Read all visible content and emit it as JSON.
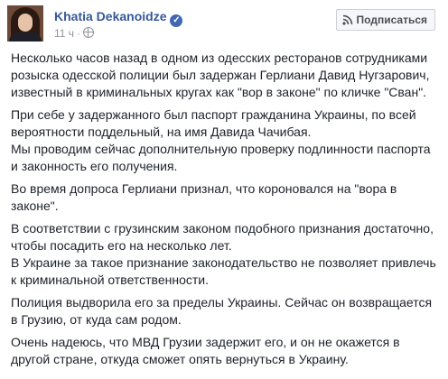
{
  "post": {
    "author": "Khatia Dekanoidze",
    "time": "11 ч",
    "subscribe_label": "Подписаться",
    "paragraphs": [
      "Несколько часов назад в одном из одесских ресторанов сотрудниками\nрозыска одесской полиции был задержан Герлиани Давид Нугзарович,\nизвестный в криминальных кругах как \"вор в законе\" по кличке \"Сван\".",
      "При себе у задержанного был паспорт гражданина Украины, по всей\nвероятности поддельный, на имя Давида Чачибая.\nМы проводим сейчас дополнительную проверку подлинности паспорта\nи законность его получения.",
      "Во время допроса Герлиани признал, что короновался на \"вора в\nзаконе\".",
      "В соответствии с грузинским законом подобного признания достаточно,\nчтобы посадить его на несколько лет.\nВ Украине за такое признание законодательство не позволяет привлечь\nк криминальной ответственности.",
      "Полиция выдворила его за пределы Украины. Сейчас он возвращается\nв Грузию, от куда сам родом.",
      "Очень надеюсь, что МВД Грузии задержит его, и он не окажется в\nдругой стране, откуда сможет опять вернуться в Украину."
    ]
  },
  "icons": {
    "verified": "verified-badge-icon",
    "privacy": "globe-icon",
    "subscribe": "rss-icon"
  },
  "colors": {
    "author_link": "#365899",
    "meta_gray": "#90949c",
    "text": "#1d2129",
    "verified_blue": "#4267b2"
  }
}
